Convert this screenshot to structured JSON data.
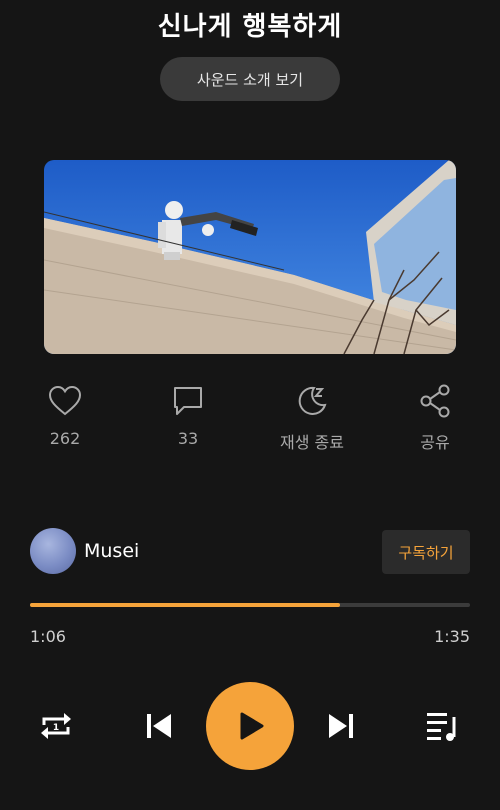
{
  "header": {
    "title": "신나게 행복하게",
    "sound_button_label": "사운드 소개 보기"
  },
  "thumbnail": {
    "icon": "robot-statue-photo"
  },
  "actions": [
    {
      "icon": "heart-icon",
      "label": "262"
    },
    {
      "icon": "comment-icon",
      "label": "33"
    },
    {
      "icon": "sleep-timer-icon",
      "label": "재생 종료"
    },
    {
      "icon": "share-icon",
      "label": "공유"
    }
  ],
  "channel": {
    "name": "Musei",
    "subscribe_label": "구독하기"
  },
  "player": {
    "current_time": "1:06",
    "total_time": "1:35",
    "progress": 0.705
  },
  "controls": [
    "repeat-one-icon",
    "previous-icon",
    "play-icon",
    "next-icon",
    "playlist-icon"
  ],
  "colors": {
    "accent": "#f5a33a",
    "background": "#151515"
  }
}
